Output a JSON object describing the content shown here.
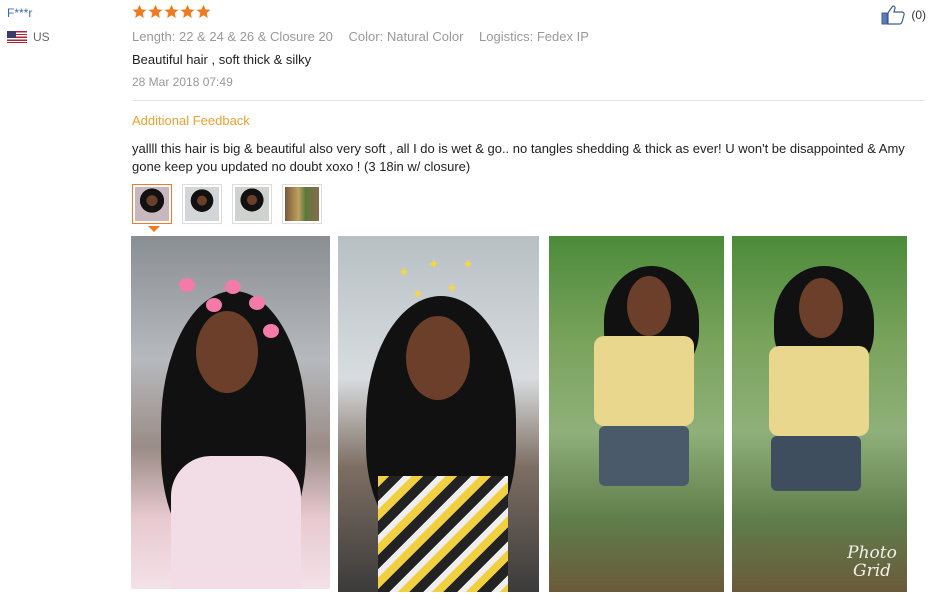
{
  "reviewer": {
    "name": "F***r",
    "country": "US"
  },
  "review": {
    "rating": 5,
    "attributes": [
      "Length: 22 & 24 & 26 & Closure 20",
      "Color: Natural Color",
      "Logistics: Fedex IP"
    ],
    "text": "Beautiful hair , soft thick & silky",
    "date": "28 Mar 2018 07:49"
  },
  "additional": {
    "title": "Additional Feedback",
    "text": "yallll this hair is big & beautiful also very soft , all I do is wet & go.. no tangles shedding & thick as ever! U won't be disappointed & Amy gone keep you updated no doubt xoxo ! (3 18in w/ closure)"
  },
  "like": {
    "count": "(0)"
  },
  "photo_overlay": {
    "watermark": "Photo Grid"
  },
  "colors": {
    "accent": "#f07a1f",
    "star": "#f07a1f",
    "link": "#3b6bb0",
    "feedback_title": "#f0a030"
  }
}
